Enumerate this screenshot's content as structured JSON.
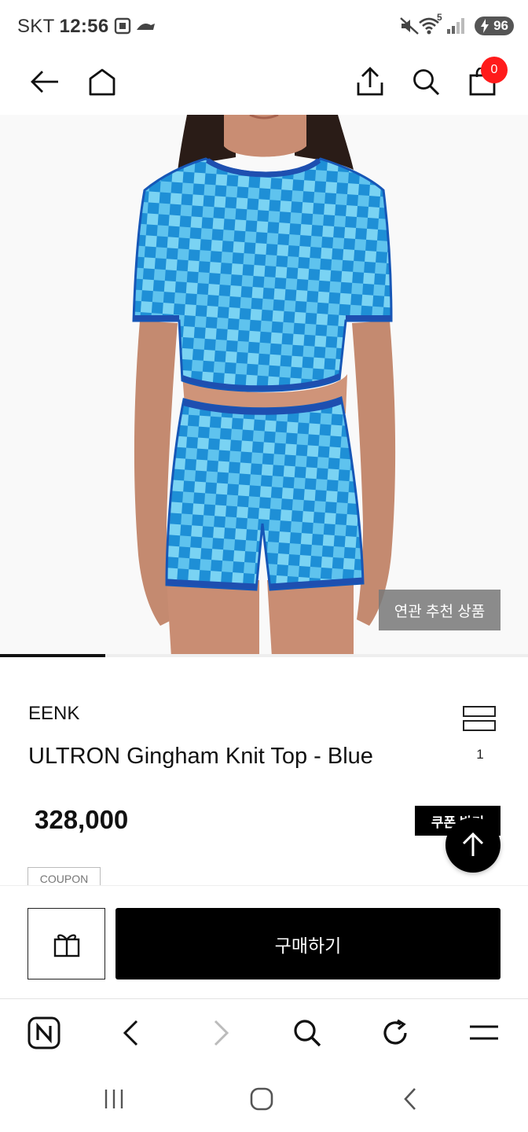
{
  "status_bar": {
    "carrier": "SKT",
    "time": "12:56",
    "wifi_badge": "5",
    "battery": "96",
    "icons": [
      "screenshot-icon",
      "app-notification-icon",
      "mute-icon",
      "wifi-icon",
      "signal-icon",
      "battery-icon"
    ]
  },
  "header": {
    "cart_count": "0",
    "icons": [
      "back-arrow-icon",
      "home-icon",
      "share-icon",
      "search-icon",
      "shopping-bag-icon"
    ]
  },
  "hero": {
    "related_products_label": "연관 추천 상품",
    "image_progress_fraction": 0.2
  },
  "product": {
    "brand": "EENK",
    "name": "ULTRON Gingham Knit Top - Blue",
    "compare_count": "1",
    "price": "328,000",
    "coupon_button": "쿠폰 받기",
    "coupon_tag": "COUPON"
  },
  "actions": {
    "buy_label": "구매하기",
    "gift_icon": "gift-icon"
  },
  "browser_toolbar": {
    "icons": [
      "naver-home-icon",
      "browser-back-icon",
      "browser-forward-icon",
      "browser-search-icon",
      "refresh-icon",
      "menu-icon"
    ]
  },
  "system_nav": {
    "icons": [
      "recent-apps-icon",
      "home-circle-icon",
      "system-back-icon"
    ]
  },
  "colors": {
    "badge": "#ff1b1b",
    "primary_button": "#000000",
    "knit_dark": "#1b8fd8",
    "knit_light": "#7fd4f5"
  }
}
